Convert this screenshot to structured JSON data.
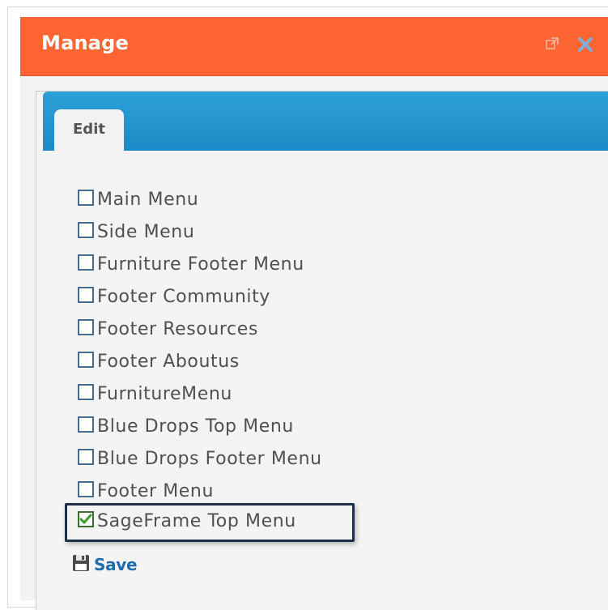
{
  "dialog": {
    "title": "Manage",
    "icons": [
      "external-link-icon",
      "close-icon"
    ]
  },
  "tabs": [
    {
      "label": "Edit"
    }
  ],
  "menus": [
    {
      "label": "Main Menu",
      "checked": false
    },
    {
      "label": "Side Menu",
      "checked": false
    },
    {
      "label": "Furniture Footer Menu",
      "checked": false
    },
    {
      "label": "Footer Community",
      "checked": false
    },
    {
      "label": "Footer Resources",
      "checked": false
    },
    {
      "label": "Footer Aboutus",
      "checked": false
    },
    {
      "label": "FurnitureMenu",
      "checked": false
    },
    {
      "label": "Blue Drops Top Menu",
      "checked": false
    },
    {
      "label": "Blue Drops Footer Menu",
      "checked": false
    },
    {
      "label": "Footer Menu",
      "checked": false
    },
    {
      "label": "SageFrame Top Menu",
      "checked": true
    }
  ],
  "save": {
    "label": "Save",
    "icon": "floppy-disk-icon"
  },
  "colors": {
    "header": "#ff6533",
    "tabbar": "#1b8ac6",
    "link": "#1e6db1",
    "check": "#3a9a2a"
  }
}
